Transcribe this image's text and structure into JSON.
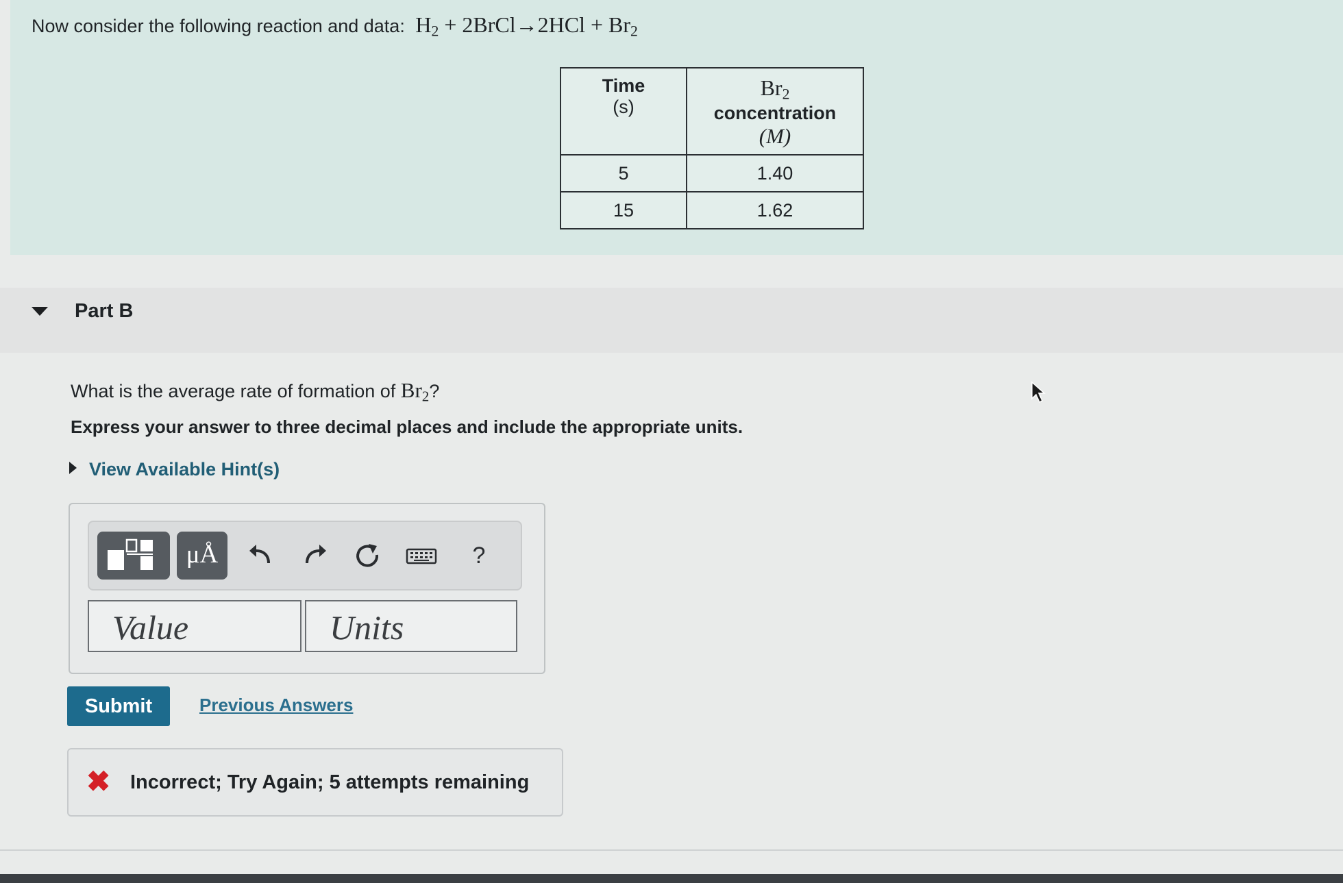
{
  "intro": {
    "text": "Now consider the following reaction and data:",
    "equation": {
      "r1": "H",
      "r1_sub": "2",
      "plus1": " + ",
      "r2": "2BrCl",
      "arrow": "→",
      "p1": "2HCl",
      "plus2": " + ",
      "p2": "Br",
      "p2_sub": "2"
    }
  },
  "table": {
    "col1_header": "Time",
    "col1_unit": "(s)",
    "col2_species": "Br",
    "col2_species_sub": "2",
    "col2_header": "concentration",
    "col2_unit": "(M)",
    "rows": [
      {
        "time": "5",
        "conc": "1.40"
      },
      {
        "time": "15",
        "conc": "1.62"
      }
    ]
  },
  "part": {
    "label": "Part B"
  },
  "question": {
    "text": "What is the average rate of formation of",
    "species": "Br",
    "species_sub": "2",
    "qmark": "?",
    "instruction": "Express your answer to three decimal places and include the appropriate units.",
    "hint_link": "View Available Hint(s)"
  },
  "toolbar": {
    "templates_icon": "templates-icon",
    "units_label": "μÅ",
    "undo_icon": "undo-icon",
    "redo_icon": "redo-icon",
    "reset_icon": "reset-icon",
    "keyboard_icon": "keyboard-icon",
    "help_label": "?"
  },
  "inputs": {
    "value_placeholder": "Value",
    "units_placeholder": "Units"
  },
  "actions": {
    "submit_label": "Submit",
    "previous_answers_label": "Previous Answers"
  },
  "feedback": {
    "message": "Incorrect; Try Again; 5 attempts remaining",
    "status_color": "#d41f26"
  },
  "colors": {
    "accent": "#1d6b8d",
    "link": "#2b6f8e",
    "intro_bg": "#d7e8e4"
  }
}
